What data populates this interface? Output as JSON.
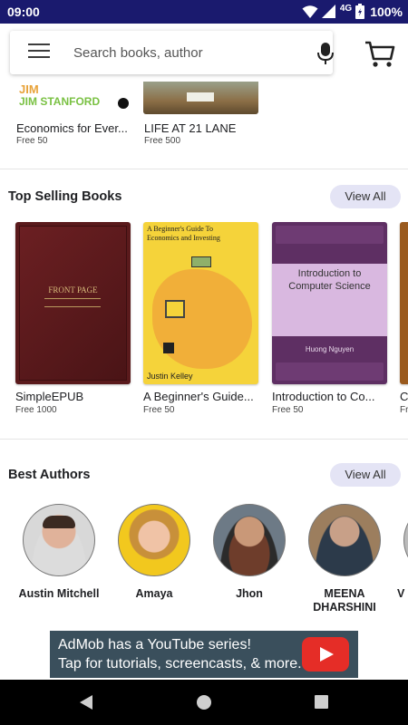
{
  "status_bar": {
    "time": "09:00",
    "network": "4G",
    "battery": "100%"
  },
  "search": {
    "placeholder": "Search books, author"
  },
  "top_books": [
    {
      "title": "Economics for Ever...",
      "price": "Free 50",
      "cover_text": "JIM STANFORD"
    },
    {
      "title": "LIFE AT 21 LANE",
      "price": "Free 500"
    }
  ],
  "top_selling": {
    "title": "Top Selling Books",
    "view_all": "View All",
    "books": [
      {
        "title": "SimpleEPUB",
        "price": "Free 1000",
        "cover_text": "FRONT PAGE"
      },
      {
        "title": "A Beginner's Guide...",
        "price": "Free 50",
        "cover_title": "A Beginner's Guide To Economics and Investing",
        "cover_author": "Justin Kelley"
      },
      {
        "title": "Introduction to Co...",
        "price": "Free 50",
        "cover_title": "Introduction to Computer Science",
        "cover_author": "Huong Nguyen"
      },
      {
        "title": "C...",
        "price": "Fr..."
      }
    ]
  },
  "best_authors": {
    "title": "Best Authors",
    "view_all": "View All",
    "authors": [
      {
        "name": "Austin Mitchell"
      },
      {
        "name": "Amaya"
      },
      {
        "name": "Jhon"
      },
      {
        "name": "MEENA DHARSHINI"
      },
      {
        "name": "V"
      }
    ]
  },
  "ad": {
    "line1": "AdMob has a YouTube series!",
    "line2": "Tap for tutorials, screencasts, & more."
  },
  "colors": {
    "status_bar": "#1a1a6e",
    "view_all_bg": "#e4e4f5",
    "ad_bg": "#3a4f5c",
    "youtube_red": "#e52d27"
  }
}
